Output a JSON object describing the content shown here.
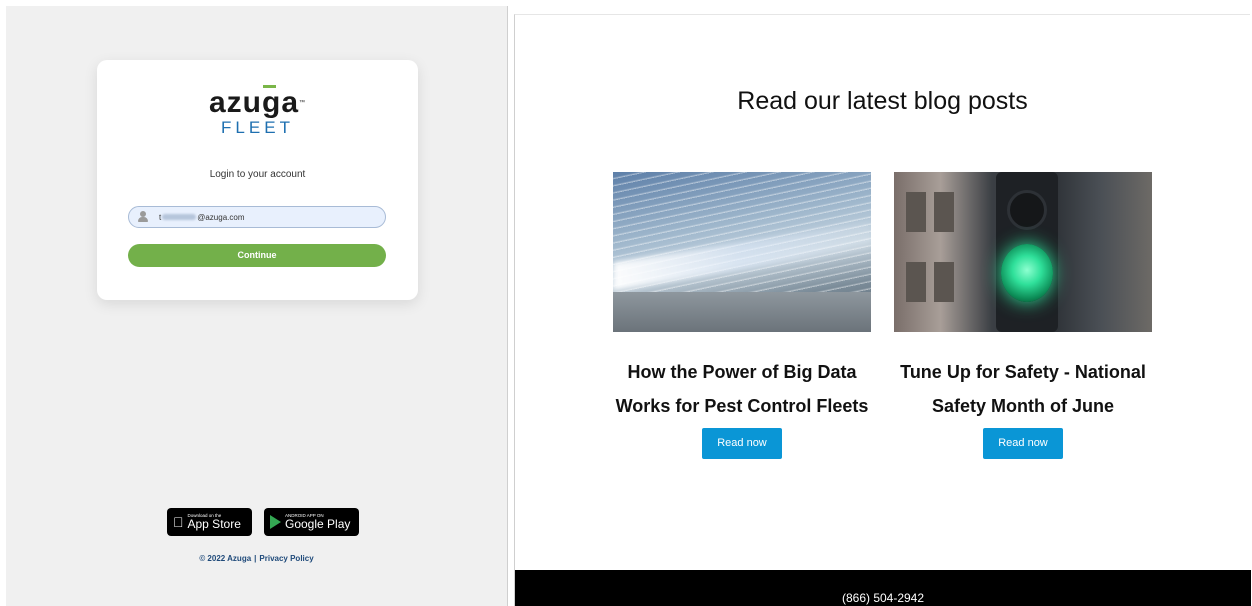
{
  "login": {
    "logo_word": "azuga",
    "logo_tm": "™",
    "logo_sub": "FLEET",
    "title": "Login to your account",
    "email_prefix": "t",
    "email_domain": "@azuga.com",
    "continue_label": "Continue"
  },
  "badges": {
    "app_store": {
      "small": "Download on the",
      "big": "App Store",
      "icon": "apple-icon"
    },
    "google_play": {
      "small": "ANDROID APP ON",
      "big": "Google Play",
      "icon": "google-play-icon"
    }
  },
  "footer_left": {
    "copyright": "© 2022 Azuga",
    "separator": "|",
    "privacy_label": "Privacy Policy"
  },
  "blog": {
    "heading": "Read our latest blog posts",
    "posts": [
      {
        "title": "How the Power of Big Data Works for Pest Control Fleets",
        "button": "Read now",
        "image": "big-data-highway-image"
      },
      {
        "title": "Tune Up for Safety - National Safety Month of June",
        "button": "Read now",
        "image": "green-traffic-light-image"
      }
    ],
    "footer_phone": "(866) 504-2942"
  },
  "colors": {
    "accent_green": "#73b04a",
    "brand_blue": "#1e6fb0",
    "read_button": "#0a96d6"
  }
}
